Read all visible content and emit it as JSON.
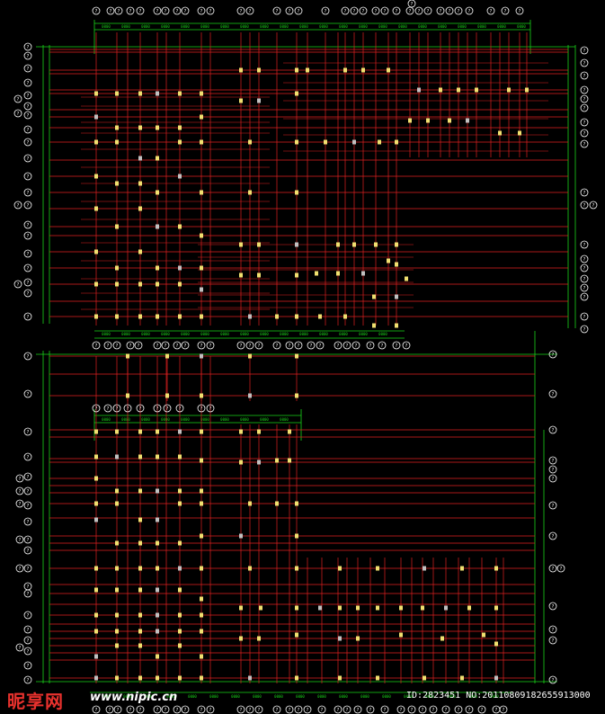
{
  "drawing": {
    "colors": {
      "background": "#000000",
      "axis_line": "#e02020",
      "dimension_line": "#19d419",
      "axis_bubble": "#ffffff",
      "column": "#f0e070",
      "column_gray": "#c0c0c0"
    },
    "axis_bubble_label": "?",
    "dimension_text": "0000",
    "floor_plans": [
      "upper-plan",
      "lower-plan"
    ]
  },
  "watermark": {
    "site_logo": "昵享网",
    "url": "www.nipic.cn",
    "id_text": "ID:2823451 NO:20110809182655913000"
  }
}
